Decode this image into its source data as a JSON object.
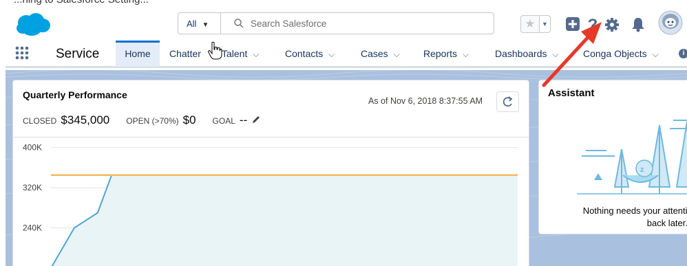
{
  "top_strip": {
    "cropped_text": "...hing to Salesforce Setting..."
  },
  "header": {
    "search": {
      "scope_label": "All",
      "placeholder": "Search Salesforce"
    },
    "icons": [
      "favorites-star-icon",
      "favorites-list-icon",
      "global-actions-plus-icon",
      "help-icon",
      "setup-gear-icon",
      "notifications-bell-icon",
      "user-avatar"
    ]
  },
  "nav": {
    "app_name": "Service",
    "tabs": [
      {
        "label": "Home",
        "active": true,
        "has_chevron": false
      },
      {
        "label": "Chatter",
        "active": false,
        "has_chevron": false
      },
      {
        "label": "Talent",
        "active": false,
        "has_chevron": true
      },
      {
        "label": "Contacts",
        "active": false,
        "has_chevron": true
      },
      {
        "label": "Cases",
        "active": false,
        "has_chevron": true
      },
      {
        "label": "Reports",
        "active": false,
        "has_chevron": true
      },
      {
        "label": "Dashboards",
        "active": false,
        "has_chevron": true
      },
      {
        "label": "Conga Objects",
        "active": false,
        "has_chevron": true
      }
    ],
    "chevron": "⌵"
  },
  "performance": {
    "title": "Quarterly Performance",
    "as_of": "As of Nov 6, 2018 8:37:55 AM",
    "closed_label": "CLOSED",
    "closed_value": "$345,000",
    "open_label": "OPEN (>70%)",
    "open_value": "$0",
    "goal_label": "GOAL",
    "goal_value": "--"
  },
  "chart_data": {
    "type": "area",
    "y_tick_labels": [
      "400K",
      "320K",
      "240K"
    ],
    "y_ticks": [
      400,
      320,
      240
    ],
    "ylim": [
      160,
      420
    ],
    "xlim": [
      0,
      100
    ],
    "goal_line_value": 345,
    "series": [
      {
        "x": [
          0,
          5,
          10,
          13,
          100
        ],
        "y": [
          160,
          240,
          270,
          345,
          345
        ]
      }
    ],
    "colors": {
      "area_fill": "#e8f4f5",
      "area_line": "#4fa3d6",
      "goal_line": "#f7b75f",
      "grid": "#e5e5e5"
    }
  },
  "assistant": {
    "title": "Assistant",
    "message_line1": "Nothing needs your attention",
    "message_line2": "back later."
  },
  "colors": {
    "brand_blue": "#00a1e0",
    "active_tab_bg": "#e3ecf8",
    "active_tab_border": "#0070d2",
    "annotation_arrow": "#e5392a"
  }
}
